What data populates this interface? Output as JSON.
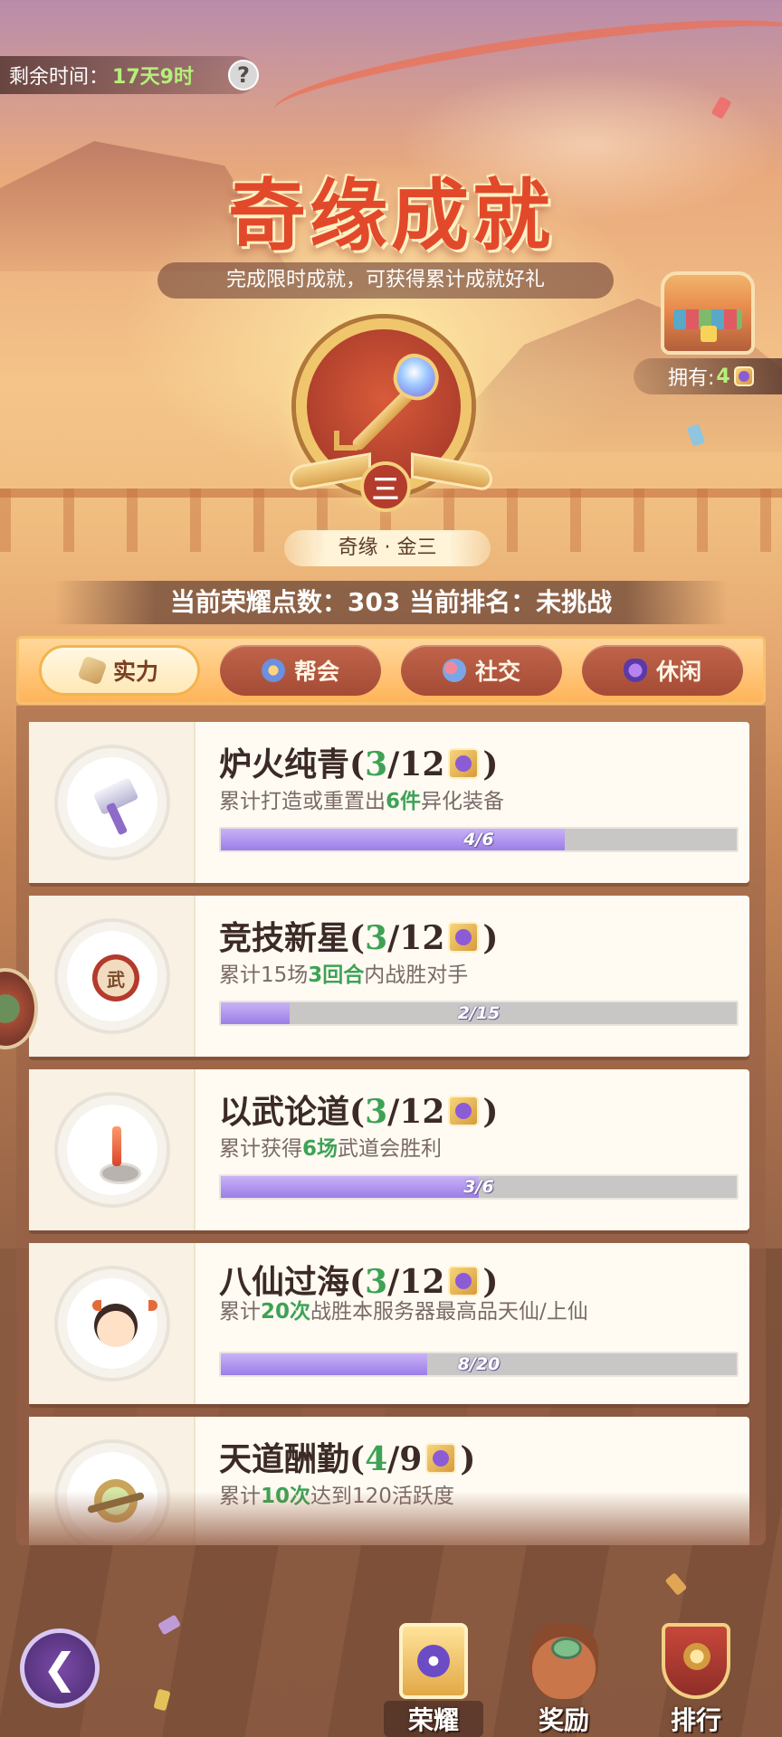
{
  "header": {
    "time_label": "剩余时间：",
    "time_value": "17天9时",
    "help_symbol": "?",
    "title": "奇缘成就",
    "subtitle": "完成限时成就，可获得累计成就好礼",
    "owned_label": "拥有:",
    "owned_count": "4"
  },
  "rank": {
    "badge_symbol": "三",
    "name": "奇缘 · 金三"
  },
  "stats": {
    "text": "当前荣耀点数：303  当前排名：未挑战"
  },
  "tabs": [
    {
      "label": "实力",
      "icon": "sword-scroll-icon",
      "active": true
    },
    {
      "label": "帮会",
      "icon": "guild-icon",
      "active": false
    },
    {
      "label": "社交",
      "icon": "social-icon",
      "active": false
    },
    {
      "label": "休闲",
      "icon": "leisure-icon",
      "active": false
    }
  ],
  "achievements": [
    {
      "icon": "hammer-icon",
      "name": "炉火纯青",
      "points_earned": "3",
      "points_total": "/12",
      "desc_pre": "累计打造或重置出",
      "desc_hl": "6件",
      "desc_post": "异化装备",
      "progress_text": "4/6",
      "progress": 0.667
    },
    {
      "icon": "drum-icon",
      "name": "竞技新星",
      "points_earned": "3",
      "points_total": "/12",
      "desc_pre": "累计15场",
      "desc_hl": "3回合",
      "desc_post": "内战胜对手",
      "progress_text": "2/15",
      "progress": 0.133
    },
    {
      "icon": "sword-altar-icon",
      "name": "以武论道",
      "points_earned": "3",
      "points_total": "/12",
      "desc_pre": "累计获得",
      "desc_hl": "6场",
      "desc_post": "武道会胜利",
      "progress_text": "3/6",
      "progress": 0.5
    },
    {
      "icon": "hero-avatar-icon",
      "name": "八仙过海",
      "points_earned": "3",
      "points_total": "/12",
      "desc_pre": "累计",
      "desc_hl": "20次",
      "desc_post": "战胜本服务器最高品天仙/上仙",
      "progress_text": "8/20",
      "progress": 0.4
    },
    {
      "icon": "compass-icon",
      "name": "天道酬勤",
      "points_earned": "4",
      "points_total": "/9",
      "desc_pre": "累计",
      "desc_hl": "10次",
      "desc_post": "达到120活跃度"
    }
  ],
  "bottom_nav": {
    "back_symbol": "❮",
    "honor": "荣耀",
    "reward": "奖励",
    "rank": "排行"
  },
  "colors": {
    "accent_green": "#3ea255",
    "title_red": "#e2492a",
    "progress_purple": "#9b7ee6"
  }
}
